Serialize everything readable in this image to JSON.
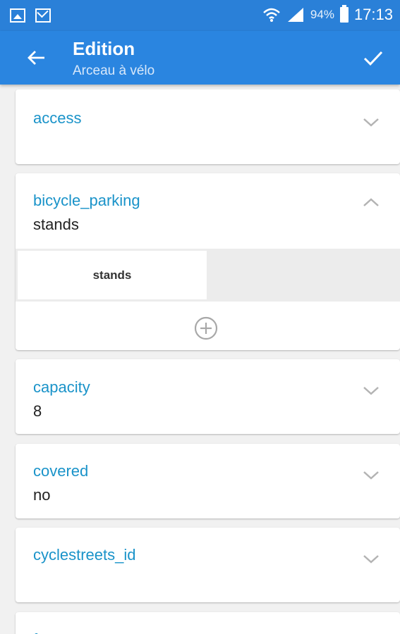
{
  "status_bar": {
    "battery_percent": "94%",
    "time": "17:13"
  },
  "app_bar": {
    "title": "Edition",
    "subtitle": "Arceau à vélo"
  },
  "tags": [
    {
      "key": "access",
      "value": "",
      "expanded": false
    },
    {
      "key": "bicycle_parking",
      "value": "stands",
      "expanded": true,
      "options": [
        "stands"
      ]
    },
    {
      "key": "capacity",
      "value": "8",
      "expanded": false
    },
    {
      "key": "covered",
      "value": "no",
      "expanded": false
    },
    {
      "key": "cyclestreets_id",
      "value": "",
      "expanded": false
    },
    {
      "key": "f",
      "value": "",
      "expanded": false
    }
  ],
  "colors": {
    "status_bar": "#2a80d8",
    "app_bar": "#2a85e0",
    "key_text": "#1a93c9",
    "background": "#f1f1f1"
  },
  "icons": {
    "back": "arrow-left-icon",
    "confirm": "check-icon",
    "collapse": "chevron-up-icon",
    "expand": "chevron-down-icon",
    "add": "add-circle-icon"
  }
}
